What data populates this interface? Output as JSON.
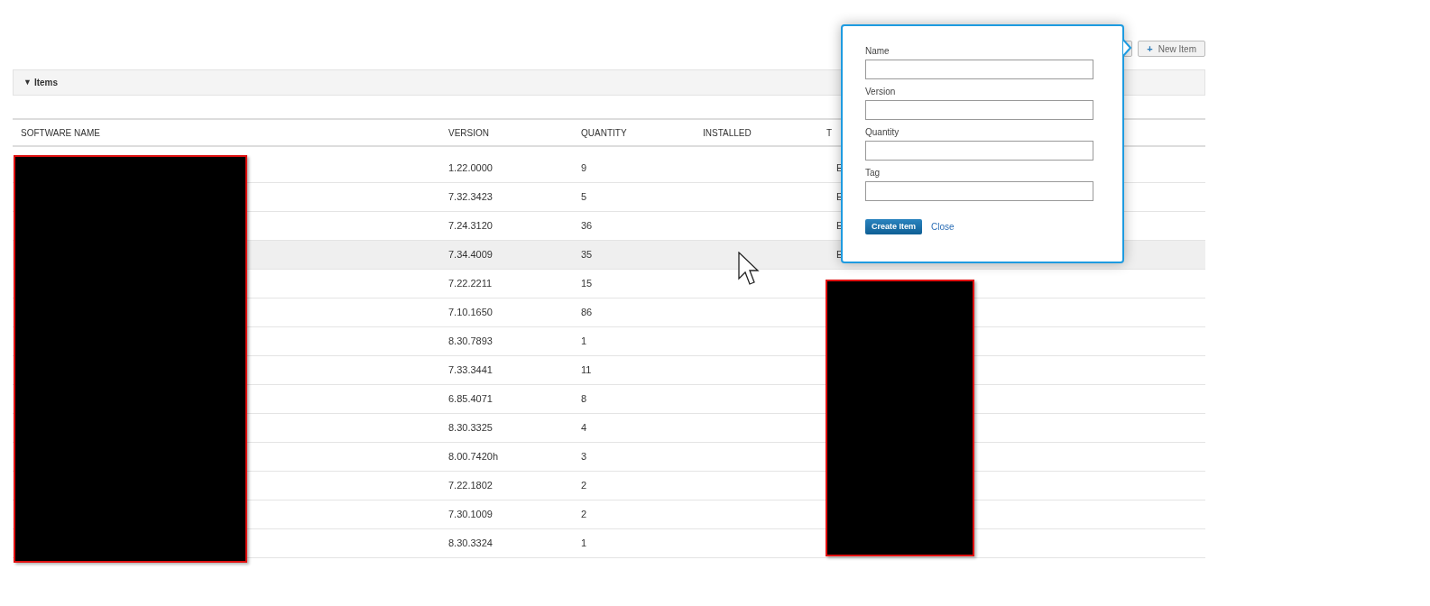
{
  "toolbar": {
    "new_item_button": {
      "icon": "+",
      "label": "New Item"
    }
  },
  "section": {
    "toggle": "▼",
    "title": "Items",
    "expanded": true
  },
  "table": {
    "columns": [
      "SOFTWARE NAME",
      "VERSION",
      "QUANTITY",
      "INSTALLED",
      "T"
    ],
    "rows": [
      {
        "version": "1.22.0000",
        "quantity": "9",
        "tag": "E",
        "highlighted": false
      },
      {
        "version": "7.32.3423",
        "quantity": "5",
        "tag": "E",
        "highlighted": false
      },
      {
        "version": "7.24.3120",
        "quantity": "36",
        "tag": "E",
        "highlighted": false
      },
      {
        "version": "7.34.4009",
        "quantity": "35",
        "tag": "E",
        "highlighted": true
      },
      {
        "version": "7.22.2211",
        "quantity": "15",
        "highlighted": false
      },
      {
        "version": "7.10.1650",
        "quantity": "86",
        "highlighted": false
      },
      {
        "version": "8.30.7893",
        "quantity": "1",
        "highlighted": false
      },
      {
        "version": "7.33.3441",
        "quantity": "11",
        "highlighted": false
      },
      {
        "version": "6.85.4071",
        "quantity": "8",
        "highlighted": false
      },
      {
        "version": "8.30.3325",
        "quantity": "4",
        "highlighted": false
      },
      {
        "version": "8.00.7420h",
        "quantity": "3",
        "highlighted": false
      },
      {
        "version": "7.22.1802",
        "quantity": "2",
        "highlighted": false
      },
      {
        "version": "7.30.1009",
        "quantity": "2",
        "highlighted": false
      },
      {
        "version": "8.30.3324",
        "quantity": "1",
        "highlighted": false
      }
    ]
  },
  "popover": {
    "fields": [
      {
        "label": "Name"
      },
      {
        "label": "Version"
      },
      {
        "label": "Quantity"
      },
      {
        "label": "Tag"
      }
    ],
    "create_button": "Create Item",
    "close_link": "Close"
  }
}
